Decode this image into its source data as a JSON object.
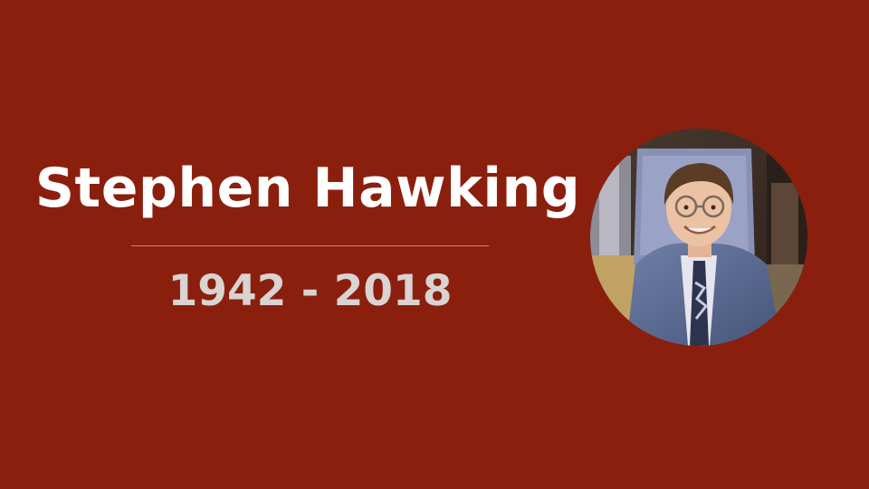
{
  "slide": {
    "title": "Stephen Hawking",
    "years": "1942 - 2018"
  },
  "colors": {
    "background": "#8b1f0e",
    "title": "#ffffff",
    "years": "#d9d3d1",
    "divider": "#c98a82"
  },
  "portrait": {
    "icon": "portrait-photo"
  }
}
